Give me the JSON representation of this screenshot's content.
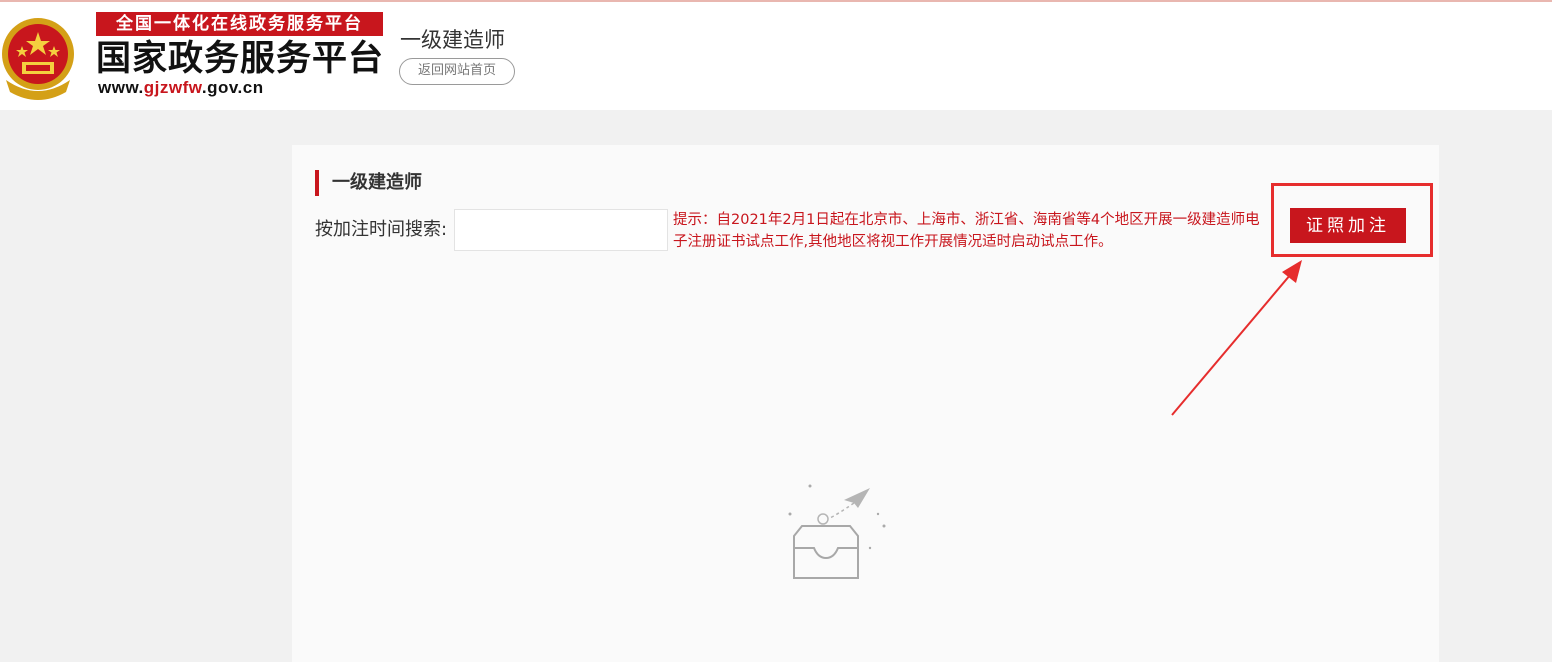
{
  "header": {
    "banner_top": "全国一体化在线政务服务平台",
    "logo_title": "国家政务服务平台",
    "url_prefix": "www.",
    "url_brand": "gjzwfw",
    "url_suffix": ".gov.cn",
    "site_name": "一级建造师",
    "home_button": "返回网站首页"
  },
  "panel": {
    "section_title": "一级建造师",
    "search_label": "按加注时间搜索:",
    "search_value": "",
    "tip": "提示：自2021年2月1日起在北京市、上海市、浙江省、海南省等4个地区开展一级建造师电子注册证书试点工作,其他地区将视工作开展情况适时启动试点工作。",
    "cert_button": "证照加注"
  },
  "colors": {
    "brand_red": "#c8161d",
    "annotation_red": "#e62d2d"
  }
}
